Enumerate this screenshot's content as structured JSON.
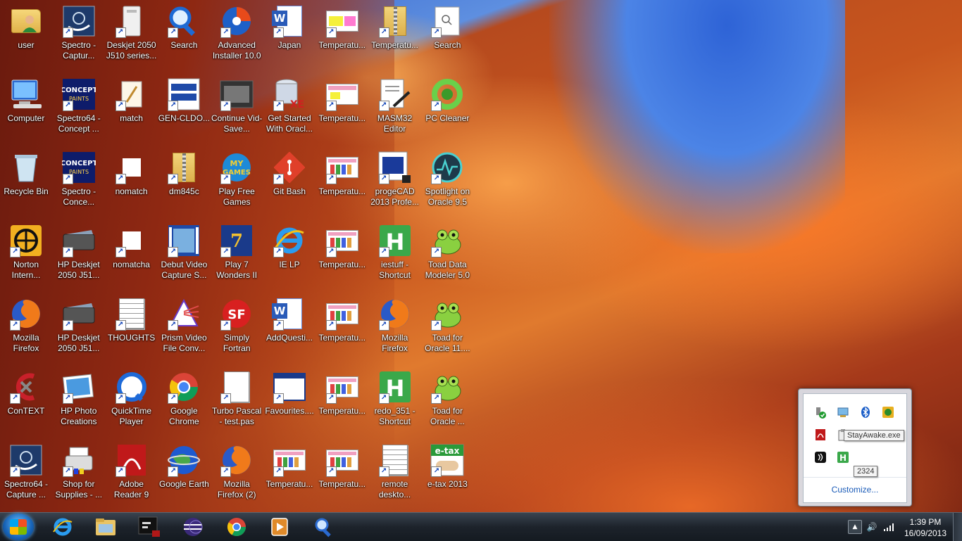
{
  "desktop": {
    "icons": [
      {
        "label": "user",
        "glyph": "user-folder"
      },
      {
        "label": "Spectro - Captur...",
        "glyph": "spectro"
      },
      {
        "label": "Deskjet 2050 J510 series...",
        "glyph": "printer-tower"
      },
      {
        "label": "Search",
        "glyph": "search"
      },
      {
        "label": "Advanced Installer 10.0",
        "glyph": "installer"
      },
      {
        "label": "Japan",
        "glyph": "word"
      },
      {
        "label": "Temperatu...",
        "glyph": "sheet-yellow"
      },
      {
        "label": "Temperatu...",
        "glyph": "zip-folder"
      },
      {
        "label": "Search",
        "glyph": "search-doc"
      },
      {
        "label": "Computer",
        "glyph": "computer"
      },
      {
        "label": "Spectro64 - Concept ...",
        "glyph": "concept"
      },
      {
        "label": "match",
        "glyph": "pencil-doc"
      },
      {
        "label": "GEN-CLDO...",
        "glyph": "gen"
      },
      {
        "label": "Continue Vid-Save...",
        "glyph": "film"
      },
      {
        "label": "Get Started With Oracl...",
        "glyph": "oracle-db"
      },
      {
        "label": "Temperatu...",
        "glyph": "sheet-pink"
      },
      {
        "label": "MASM32 Editor",
        "glyph": "masm"
      },
      {
        "label": "PC Cleaner",
        "glyph": "pc-cleaner"
      },
      {
        "label": "Recycle Bin",
        "glyph": "recycle"
      },
      {
        "label": "Spectro - Conce...",
        "glyph": "concept"
      },
      {
        "label": "nomatch",
        "glyph": "white"
      },
      {
        "label": "dm845c",
        "glyph": "zip-folder"
      },
      {
        "label": "Play Free Games",
        "glyph": "games"
      },
      {
        "label": "Git Bash",
        "glyph": "git"
      },
      {
        "label": "Temperatu...",
        "glyph": "sheet-chart"
      },
      {
        "label": "progeCAD 2013 Profe...",
        "glyph": "progecad"
      },
      {
        "label": "Spotlight on Oracle 9.5",
        "glyph": "spotlight"
      },
      {
        "label": "Norton Intern...",
        "glyph": "norton"
      },
      {
        "label": "HP Deskjet 2050 J51...",
        "glyph": "scanner"
      },
      {
        "label": "nomatcha",
        "glyph": "white"
      },
      {
        "label": "Debut Video Capture S...",
        "glyph": "debut"
      },
      {
        "label": "Play 7 Wonders II",
        "glyph": "wonders"
      },
      {
        "label": "IE LP",
        "glyph": "ie"
      },
      {
        "label": "Temperatu...",
        "glyph": "sheet-chart"
      },
      {
        "label": "iestuff - Shortcut",
        "glyph": "h-green"
      },
      {
        "label": "Toad Data Modeler 5.0",
        "glyph": "toad"
      },
      {
        "label": "Mozilla Firefox",
        "glyph": "firefox"
      },
      {
        "label": "HP Deskjet 2050 J51...",
        "glyph": "scanner"
      },
      {
        "label": "THOUGHTS",
        "glyph": "text-doc"
      },
      {
        "label": "Prism Video File Conv...",
        "glyph": "prism"
      },
      {
        "label": "Simply Fortran",
        "glyph": "fortran"
      },
      {
        "label": "AddQuesti...",
        "glyph": "word"
      },
      {
        "label": "Temperatu...",
        "glyph": "sheet-chart"
      },
      {
        "label": "Mozilla Firefox",
        "glyph": "firefox"
      },
      {
        "label": "Toad for Oracle 11....",
        "glyph": "toad"
      },
      {
        "label": "ConTEXT",
        "glyph": "context"
      },
      {
        "label": "HP Photo Creations",
        "glyph": "photo"
      },
      {
        "label": "QuickTime Player",
        "glyph": "quicktime"
      },
      {
        "label": "Google Chrome",
        "glyph": "chrome"
      },
      {
        "label": "Turbo Pascal - test.pas",
        "glyph": "blank-doc"
      },
      {
        "label": "Favourites....",
        "glyph": "window"
      },
      {
        "label": "Temperatu...",
        "glyph": "sheet-chart"
      },
      {
        "label": "redo_351 - Shortcut",
        "glyph": "h-green"
      },
      {
        "label": "Toad for Oracle ...",
        "glyph": "toad"
      },
      {
        "label": "Spectro64 - Capture ...",
        "glyph": "spectro"
      },
      {
        "label": "Shop for Supplies - ...",
        "glyph": "shop"
      },
      {
        "label": "Adobe Reader 9",
        "glyph": "adobe"
      },
      {
        "label": "Google Earth",
        "glyph": "earth"
      },
      {
        "label": "Mozilla Firefox (2)",
        "glyph": "firefox"
      },
      {
        "label": "Temperatu...",
        "glyph": "sheet-chart"
      },
      {
        "label": "Temperatu...",
        "glyph": "sheet-chart"
      },
      {
        "label": "remote deskto...",
        "glyph": "text-doc"
      },
      {
        "label": "e-tax 2013",
        "glyph": "etax"
      }
    ]
  },
  "taskbar": {
    "pinned": [
      "ie-icon",
      "explorer-icon",
      "terminal-icon",
      "eclipse-icon",
      "chrome-icon",
      "media-player-icon",
      "search-icon"
    ],
    "clock_time": "1:39 PM",
    "clock_date": "16/09/2013"
  },
  "tray_overflow": {
    "customize_label": "Customize...",
    "tooltip_stayawake": "StayAwake.exe",
    "tooltip_pid": "2324"
  },
  "colors": {
    "accent": "#1a5bb8",
    "taskbar": "#1d232b"
  }
}
